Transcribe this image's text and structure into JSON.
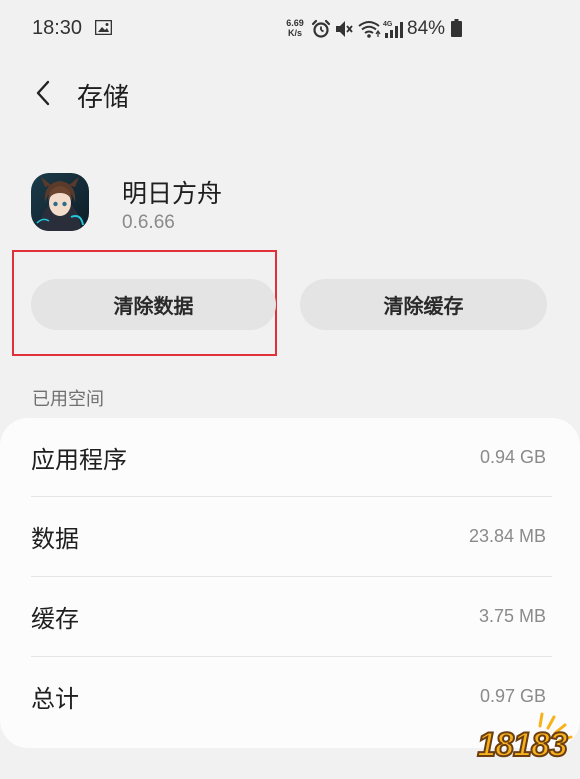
{
  "status_bar": {
    "time": "18:30",
    "network_speed_value": "6.69",
    "network_speed_unit": "K/s",
    "battery_percent": "84%",
    "icons": [
      "image-icon",
      "alarm-icon",
      "mute-icon",
      "wifi-icon",
      "signal-4g-icon",
      "battery-icon"
    ]
  },
  "header": {
    "title": "存储"
  },
  "app": {
    "name": "明日方舟",
    "version": "0.6.66"
  },
  "actions": {
    "clear_data_label": "清除数据",
    "clear_cache_label": "清除缓存"
  },
  "storage": {
    "section_title": "已用空间",
    "rows": [
      {
        "label": "应用程序",
        "value": "0.94 GB"
      },
      {
        "label": "数据",
        "value": "23.84 MB"
      },
      {
        "label": "缓存",
        "value": "3.75 MB"
      },
      {
        "label": "总计",
        "value": "0.97 GB"
      }
    ]
  },
  "watermark": {
    "text": "18183"
  },
  "colors": {
    "background": "#f1f1f1",
    "card": "#fcfcfc",
    "button": "#e4e4e4",
    "highlight": "#e0313a",
    "secondary_text": "#8a8a8a"
  }
}
